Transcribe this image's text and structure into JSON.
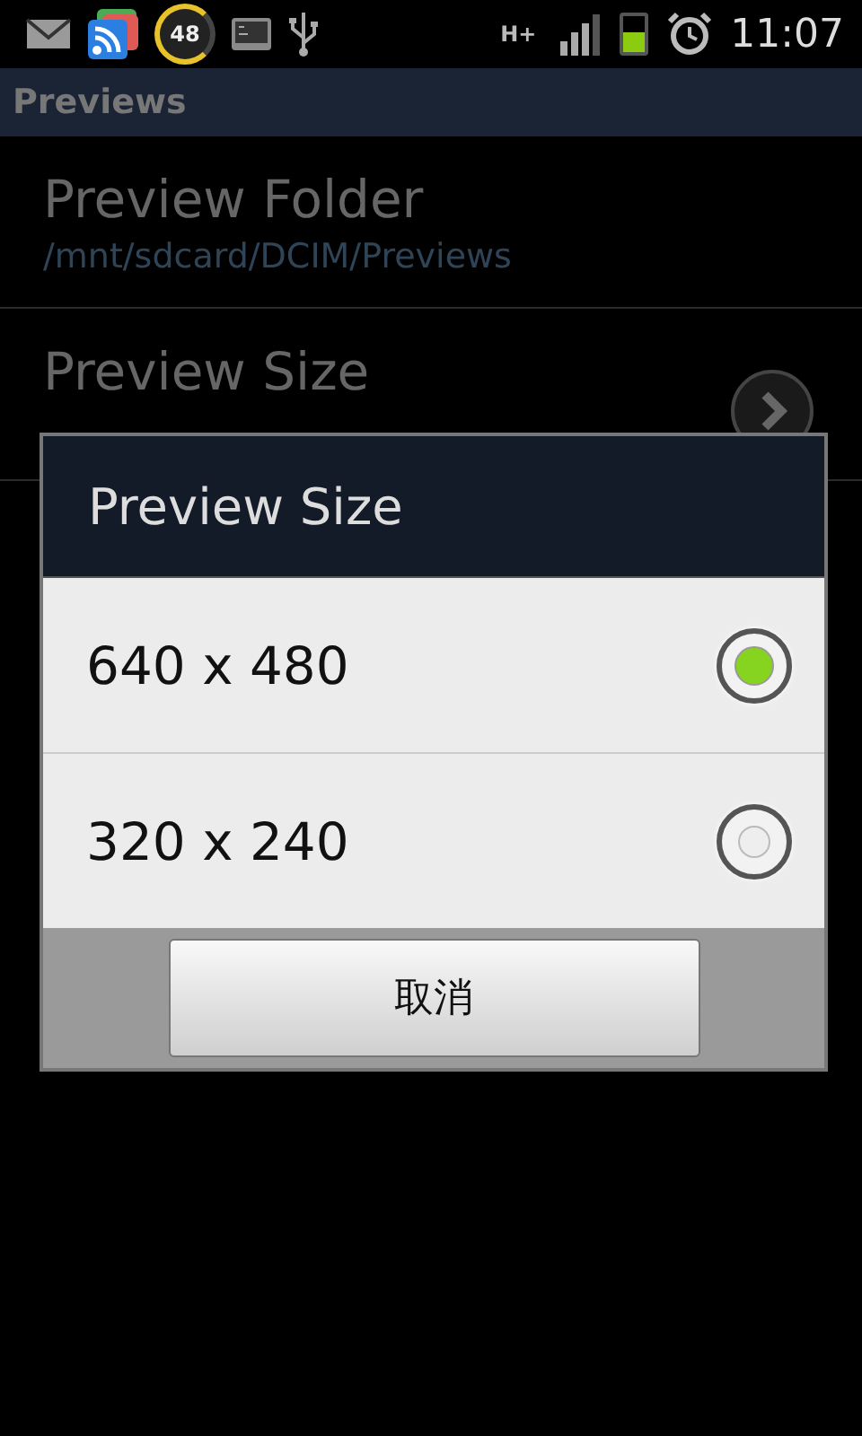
{
  "status_bar": {
    "badge": "48",
    "network": "H+",
    "time": "11:07"
  },
  "app_title": "Previews",
  "preferences": [
    {
      "kind": "text",
      "title": "Preview Folder",
      "summary": "/mnt/sdcard/DCIM/Previews"
    },
    {
      "kind": "arrow",
      "title": "Preview Size"
    }
  ],
  "dialog": {
    "title": "Preview Size",
    "options": [
      {
        "label": "640 x 480",
        "selected": true
      },
      {
        "label": "320 x 240",
        "selected": false
      }
    ],
    "buttons": [
      "取消"
    ]
  }
}
